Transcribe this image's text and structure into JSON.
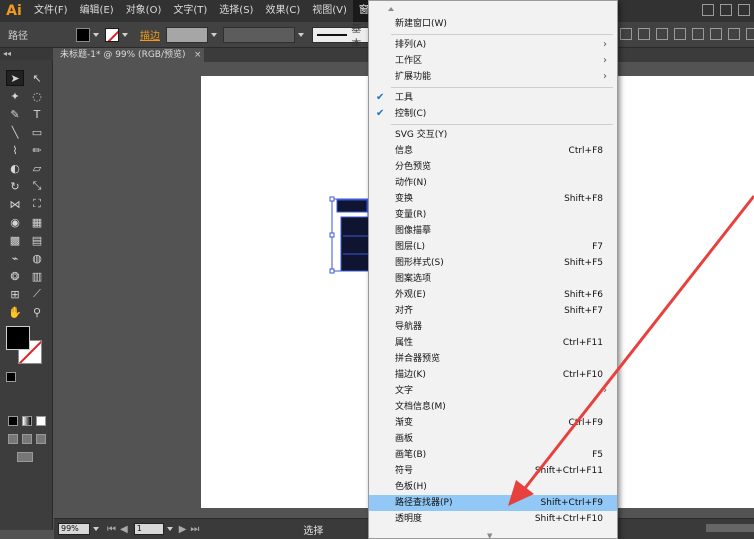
{
  "app": {
    "logo": "Ai",
    "menu": [
      "文件(F)",
      "编辑(E)",
      "对象(O)",
      "文字(T)",
      "选择(S)",
      "效果(C)",
      "视图(V)",
      "窗口(W)"
    ],
    "active_menu_index": 7
  },
  "control_bar": {
    "path_label": "路径",
    "stroke_label": "描边",
    "style_text": "基本"
  },
  "document": {
    "tab_title": "未标题-1* @ 99% (RGB/预览)",
    "close_glyph": "×"
  },
  "status_bar": {
    "zoom": "99%",
    "page": "1",
    "selection_text": "选择"
  },
  "window_menu": {
    "items": [
      {
        "label": "新建窗口(W)",
        "shortcut": "",
        "submenu": false,
        "checked": false,
        "highlighted": false
      },
      {
        "label": "排列(A)",
        "shortcut": "",
        "submenu": true,
        "checked": false,
        "highlighted": false
      },
      {
        "label": "工作区",
        "shortcut": "",
        "submenu": true,
        "checked": false,
        "highlighted": false
      },
      {
        "label": "扩展功能",
        "shortcut": "",
        "submenu": true,
        "checked": false,
        "highlighted": false
      },
      {
        "label": "工具",
        "shortcut": "",
        "submenu": false,
        "checked": true,
        "highlighted": false
      },
      {
        "label": "控制(C)",
        "shortcut": "",
        "submenu": false,
        "checked": true,
        "highlighted": false
      },
      {
        "label": "SVG 交互(Y)",
        "shortcut": "",
        "submenu": false,
        "checked": false,
        "highlighted": false
      },
      {
        "label": "信息",
        "shortcut": "Ctrl+F8",
        "submenu": false,
        "checked": false,
        "highlighted": false
      },
      {
        "label": "分色预览",
        "shortcut": "",
        "submenu": false,
        "checked": false,
        "highlighted": false
      },
      {
        "label": "动作(N)",
        "shortcut": "",
        "submenu": false,
        "checked": false,
        "highlighted": false
      },
      {
        "label": "变换",
        "shortcut": "Shift+F8",
        "submenu": false,
        "checked": false,
        "highlighted": false
      },
      {
        "label": "变量(R)",
        "shortcut": "",
        "submenu": false,
        "checked": false,
        "highlighted": false
      },
      {
        "label": "图像描摹",
        "shortcut": "",
        "submenu": false,
        "checked": false,
        "highlighted": false
      },
      {
        "label": "图层(L)",
        "shortcut": "F7",
        "submenu": false,
        "checked": false,
        "highlighted": false
      },
      {
        "label": "图形样式(S)",
        "shortcut": "Shift+F5",
        "submenu": false,
        "checked": false,
        "highlighted": false
      },
      {
        "label": "图案选项",
        "shortcut": "",
        "submenu": false,
        "checked": false,
        "highlighted": false
      },
      {
        "label": "外观(E)",
        "shortcut": "Shift+F6",
        "submenu": false,
        "checked": false,
        "highlighted": false
      },
      {
        "label": "对齐",
        "shortcut": "Shift+F7",
        "submenu": false,
        "checked": false,
        "highlighted": false
      },
      {
        "label": "导航器",
        "shortcut": "",
        "submenu": false,
        "checked": false,
        "highlighted": false
      },
      {
        "label": "属性",
        "shortcut": "Ctrl+F11",
        "submenu": false,
        "checked": false,
        "highlighted": false
      },
      {
        "label": "拼合器预览",
        "shortcut": "",
        "submenu": false,
        "checked": false,
        "highlighted": false
      },
      {
        "label": "描边(K)",
        "shortcut": "Ctrl+F10",
        "submenu": false,
        "checked": false,
        "highlighted": false
      },
      {
        "label": "文字",
        "shortcut": "",
        "submenu": true,
        "checked": false,
        "highlighted": false
      },
      {
        "label": "文档信息(M)",
        "shortcut": "",
        "submenu": false,
        "checked": false,
        "highlighted": false
      },
      {
        "label": "渐变",
        "shortcut": "Ctrl+F9",
        "submenu": false,
        "checked": false,
        "highlighted": false
      },
      {
        "label": "画板",
        "shortcut": "",
        "submenu": false,
        "checked": false,
        "highlighted": false
      },
      {
        "label": "画笔(B)",
        "shortcut": "F5",
        "submenu": false,
        "checked": false,
        "highlighted": false
      },
      {
        "label": "符号",
        "shortcut": "Shift+Ctrl+F11",
        "submenu": false,
        "checked": false,
        "highlighted": false
      },
      {
        "label": "色板(H)",
        "shortcut": "",
        "submenu": false,
        "checked": false,
        "highlighted": false
      },
      {
        "label": "路径查找器(P)",
        "shortcut": "Shift+Ctrl+F9",
        "submenu": false,
        "checked": false,
        "highlighted": true
      },
      {
        "label": "透明度",
        "shortcut": "Shift+Ctrl+F10",
        "submenu": false,
        "checked": false,
        "highlighted": false
      }
    ],
    "submenu_glyph": "›",
    "check_glyph": "✔",
    "highlight_color": "#91c8f6"
  },
  "colors": {
    "accent": "#f39a1d",
    "annotation_arrow": "#e8403c"
  }
}
